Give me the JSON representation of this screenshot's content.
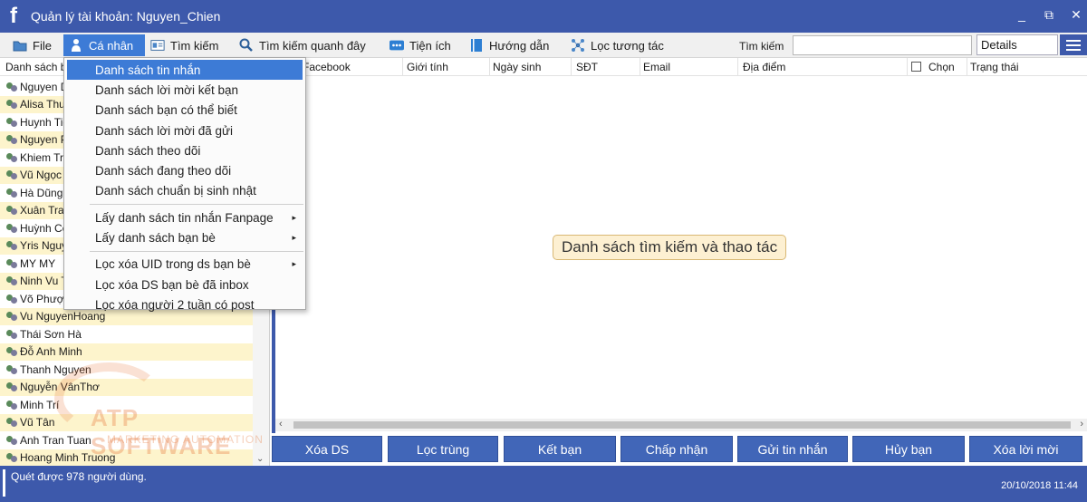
{
  "window": {
    "title": "Quản lý tài khoản: Nguyen_Chien",
    "logo": "f",
    "controls": [
      "_",
      "⧉",
      "✕"
    ]
  },
  "menubar": {
    "items": [
      {
        "label": "File",
        "icon": "folder-icon"
      },
      {
        "label": "Cá nhân",
        "icon": "person-icon"
      },
      {
        "label": "Tìm kiếm",
        "icon": "id-card-icon"
      },
      {
        "label": "Tìm kiếm quanh đây",
        "icon": "search-icon"
      },
      {
        "label": "Tiện ích",
        "icon": "dots-icon"
      },
      {
        "label": "Hướng dẫn",
        "icon": "book-icon"
      },
      {
        "label": "Lọc tương tác",
        "icon": "network-icon"
      }
    ],
    "search_label": "Tìm kiếm",
    "search_value": "",
    "view_select": "Details"
  },
  "left_panel": {
    "header": "Danh sách bạn bè",
    "contacts": [
      "Nguyen Duy",
      "Alisa Thu",
      "Huynh Tien",
      "Nguyen Phuong",
      "Khiem Tran",
      "Vũ Ngọc",
      "Hà Dũng",
      "Xuân Trang",
      "Huỳnh Công",
      "Yris Nguyen",
      "MY MY",
      "Ninh Vu Thu",
      "Võ Phượng",
      "Vu NguyenHoang",
      "Thái Sơn Hà",
      "Đỗ Anh Minh",
      "Thanh Nguyen",
      "Nguyễn VânThơ",
      "Minh Trí",
      "Vũ Tân",
      "Anh Tran Tuan",
      "Hoang Minh Truong"
    ],
    "watermark_main": "ATP SOFTWARE",
    "watermark_sub": "MARKETING AUTOMATION"
  },
  "table": {
    "columns": [
      "Facebook",
      "Giới tính",
      "Ngày sinh",
      "SĐT",
      "Email",
      "Địa điểm",
      "Chọn",
      "Trạng thái"
    ],
    "placeholder": "Danh sách tìm kiếm và thao tác"
  },
  "actions": [
    "Xóa DS",
    "Lọc trùng",
    "Kết bạn",
    "Chấp nhận",
    "Gửi tin nhắn",
    "Hủy bạn",
    "Xóa lời mời"
  ],
  "dropdown": {
    "group1": [
      "Danh sách tin nhắn",
      "Danh sách lời mời kết bạn",
      "Danh sách bạn có thể biết",
      "Danh sách lời mời đã gửi",
      "Danh sách theo dõi",
      "Danh sách đang theo dõi",
      "Danh sách chuẩn bị sinh nhật"
    ],
    "group2": [
      "Lấy danh sách tin nhắn Fanpage",
      "Lấy danh sách bạn bè"
    ],
    "group3": [
      "Lọc xóa UID trong ds bạn bè",
      "Lọc xóa DS bạn bè đã inbox",
      "Lọc xóa người 2 tuần có post"
    ],
    "submenu_arrow": "▸"
  },
  "statusbar": {
    "message": "Quét được 978 người dùng.",
    "datetime": "20/10/2018 11:44"
  },
  "colors": {
    "brand": "#3d59ab",
    "highlight": "#3d7bd6",
    "row_alt": "#fdf4cc",
    "button": "#4166b8"
  }
}
